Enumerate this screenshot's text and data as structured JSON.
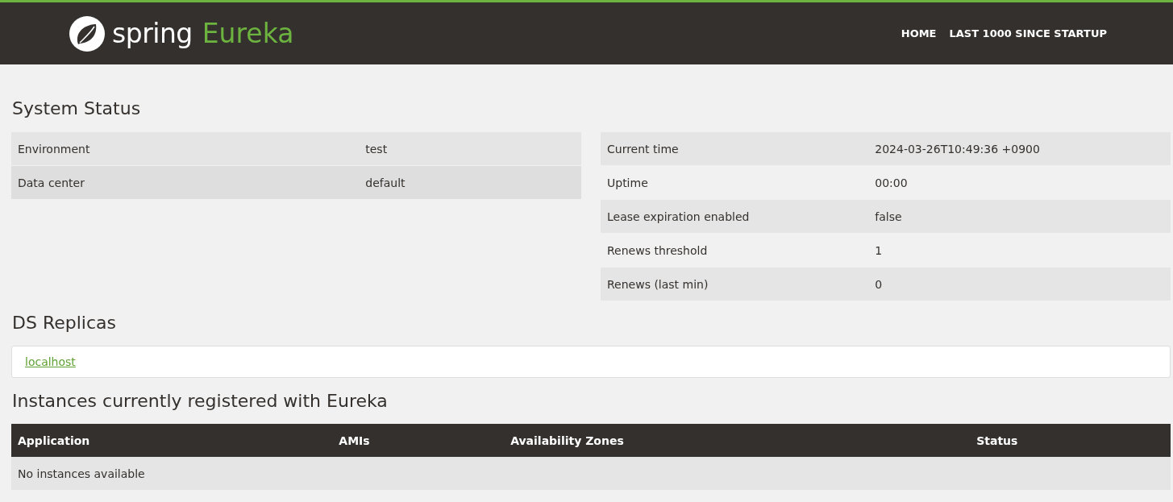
{
  "header": {
    "logo_primary": "spring",
    "logo_secondary": "Eureka",
    "nav": [
      {
        "label": "HOME"
      },
      {
        "label": "LAST 1000 SINCE STARTUP"
      }
    ]
  },
  "system_status": {
    "title": "System Status",
    "left_table": [
      {
        "name": "Environment",
        "value": "test"
      },
      {
        "name": "Data center",
        "value": "default"
      }
    ],
    "right_table": [
      {
        "name": "Current time",
        "value": "2024-03-26T10:49:36 +0900"
      },
      {
        "name": "Uptime",
        "value": "00:00"
      },
      {
        "name": "Lease expiration enabled",
        "value": "false"
      },
      {
        "name": "Renews threshold",
        "value": "1"
      },
      {
        "name": "Renews (last min)",
        "value": "0"
      }
    ]
  },
  "ds_replicas": {
    "title": "DS Replicas",
    "links": [
      "localhost"
    ]
  },
  "instances": {
    "title": "Instances currently registered with Eureka",
    "columns": [
      "Application",
      "AMIs",
      "Availability Zones",
      "Status"
    ],
    "empty_message": "No instances available"
  }
}
